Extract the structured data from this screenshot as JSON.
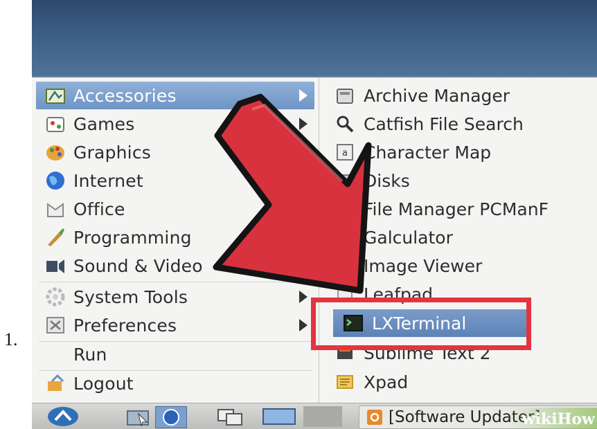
{
  "list_number": "1.",
  "menu": {
    "categories": [
      {
        "label": "Accessories",
        "icon": "accessories-icon",
        "selected": true,
        "has_submenu": true
      },
      {
        "label": "Games",
        "icon": "games-icon",
        "has_submenu": true
      },
      {
        "label": "Graphics",
        "icon": "graphics-icon"
      },
      {
        "label": "Internet",
        "icon": "internet-icon"
      },
      {
        "label": "Office",
        "icon": "office-icon"
      },
      {
        "label": "Programming",
        "icon": "programming-icon"
      },
      {
        "label": "Sound & Video",
        "icon": "sound-video-icon",
        "has_submenu": true
      },
      {
        "label": "System Tools",
        "icon": "system-tools-icon",
        "has_submenu": true
      },
      {
        "label": "Preferences",
        "icon": "preferences-icon",
        "has_submenu": true
      },
      {
        "label": "Run",
        "icon": ""
      },
      {
        "label": "Logout",
        "icon": "logout-icon"
      }
    ],
    "accessories": [
      {
        "label": "Archive Manager",
        "icon": "archive-manager-icon"
      },
      {
        "label": "Catfish File Search",
        "icon": "search-icon"
      },
      {
        "label": "Character Map",
        "icon": "character-map-icon"
      },
      {
        "label": "Disks",
        "icon": "disks-icon"
      },
      {
        "label": "File Manager PCManF",
        "icon": "file-manager-icon"
      },
      {
        "label": "Galculator",
        "icon": "calculator-icon"
      },
      {
        "label": "Image Viewer",
        "icon": "image-viewer-icon"
      },
      {
        "label": "Leafpad",
        "icon": "leafpad-icon"
      },
      {
        "label": "LXTerminal",
        "icon": "terminal-icon",
        "selected": true
      },
      {
        "label": "Sublime Text 2",
        "icon": "sublime-text-icon"
      },
      {
        "label": "Xpad",
        "icon": "xpad-icon"
      }
    ]
  },
  "taskbar": {
    "window_title": "[Software Updater]",
    "watermark": "wikiHow"
  },
  "colors": {
    "selection": "#7397c6",
    "highlight_box": "#e3353f",
    "arrow_fill": "#d9323f"
  }
}
